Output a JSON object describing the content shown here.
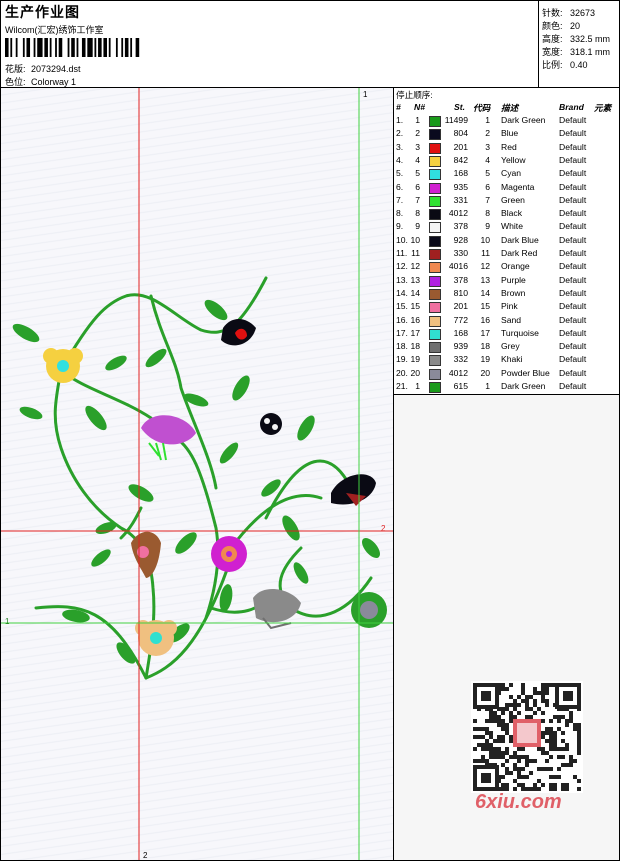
{
  "header": {
    "title": "生产作业图",
    "software": "Wilcom(汇宏)绣饰工作室",
    "design_label": "花版:",
    "design_value": "2073294.dst",
    "colorway_label": "色位:",
    "colorway_value": "Colorway 1"
  },
  "stats": {
    "stitches_label": "针数:",
    "stitches_value": "32673",
    "colors_label": "颜色:",
    "colors_value": "20",
    "height_label": "高度:",
    "height_value": "332.5 mm",
    "width_label": "宽度:",
    "width_value": "318.1 mm",
    "scale_label": "比例:",
    "scale_value": "0.40"
  },
  "stop_sequence": {
    "title": "停止顺序:",
    "headers": {
      "num": "#",
      "n": "N#",
      "st": "St.",
      "code": "代码",
      "desc": "描述",
      "brand": "Brand",
      "elements": "元素"
    },
    "rows": [
      {
        "num": "1.",
        "n": "1",
        "color": "#1a9a1a",
        "st": "11499",
        "code": "1",
        "desc": "Dark Green",
        "brand": "Default"
      },
      {
        "num": "2.",
        "n": "2",
        "color": "#0a0a1e",
        "st": "804",
        "code": "2",
        "desc": "Blue",
        "brand": "Default"
      },
      {
        "num": "3.",
        "n": "3",
        "color": "#e01010",
        "st": "201",
        "code": "3",
        "desc": "Red",
        "brand": "Default"
      },
      {
        "num": "4.",
        "n": "4",
        "color": "#f5d040",
        "st": "842",
        "code": "4",
        "desc": "Yellow",
        "brand": "Default"
      },
      {
        "num": "5.",
        "n": "5",
        "color": "#30e0e0",
        "st": "168",
        "code": "5",
        "desc": "Cyan",
        "brand": "Default"
      },
      {
        "num": "6.",
        "n": "6",
        "color": "#d020d0",
        "st": "935",
        "code": "6",
        "desc": "Magenta",
        "brand": "Default"
      },
      {
        "num": "7.",
        "n": "7",
        "color": "#30e030",
        "st": "331",
        "code": "7",
        "desc": "Green",
        "brand": "Default"
      },
      {
        "num": "8.",
        "n": "8",
        "color": "#0a0a14",
        "st": "4012",
        "code": "8",
        "desc": "Black",
        "brand": "Default"
      },
      {
        "num": "9.",
        "n": "9",
        "color": "#f4f4f4",
        "st": "378",
        "code": "9",
        "desc": "White",
        "brand": "Default"
      },
      {
        "num": "10.",
        "n": "10",
        "color": "#0a0a1a",
        "st": "928",
        "code": "10",
        "desc": "Dark Blue",
        "brand": "Default"
      },
      {
        "num": "11.",
        "n": "11",
        "color": "#a02020",
        "st": "330",
        "code": "11",
        "desc": "Dark Red",
        "brand": "Default"
      },
      {
        "num": "12.",
        "n": "12",
        "color": "#f08850",
        "st": "4016",
        "code": "12",
        "desc": "Orange",
        "brand": "Default"
      },
      {
        "num": "13.",
        "n": "13",
        "color": "#b020e0",
        "st": "378",
        "code": "13",
        "desc": "Purple",
        "brand": "Default"
      },
      {
        "num": "14.",
        "n": "14",
        "color": "#9a5a30",
        "st": "810",
        "code": "14",
        "desc": "Brown",
        "brand": "Default"
      },
      {
        "num": "15.",
        "n": "15",
        "color": "#f070a0",
        "st": "201",
        "code": "15",
        "desc": "Pink",
        "brand": "Default"
      },
      {
        "num": "16.",
        "n": "16",
        "color": "#f0c080",
        "st": "772",
        "code": "16",
        "desc": "Sand",
        "brand": "Default"
      },
      {
        "num": "17.",
        "n": "17",
        "color": "#30e0d0",
        "st": "168",
        "code": "17",
        "desc": "Turquoise",
        "brand": "Default"
      },
      {
        "num": "18.",
        "n": "18",
        "color": "#707070",
        "st": "939",
        "code": "18",
        "desc": "Grey",
        "brand": "Default"
      },
      {
        "num": "19.",
        "n": "19",
        "color": "#8a8a8a",
        "st": "332",
        "code": "19",
        "desc": "Khaki",
        "brand": "Default"
      },
      {
        "num": "20.",
        "n": "20",
        "color": "#8a8a9a",
        "st": "4012",
        "code": "20",
        "desc": "Powder Blue",
        "brand": "Default"
      },
      {
        "num": "21.",
        "n": "1",
        "color": "#1a9a1a",
        "st": "615",
        "code": "1",
        "desc": "Dark Green",
        "brand": "Default"
      }
    ]
  },
  "guides": {
    "label_1": "1",
    "label_2": "2"
  },
  "watermark": "6xiu.com"
}
